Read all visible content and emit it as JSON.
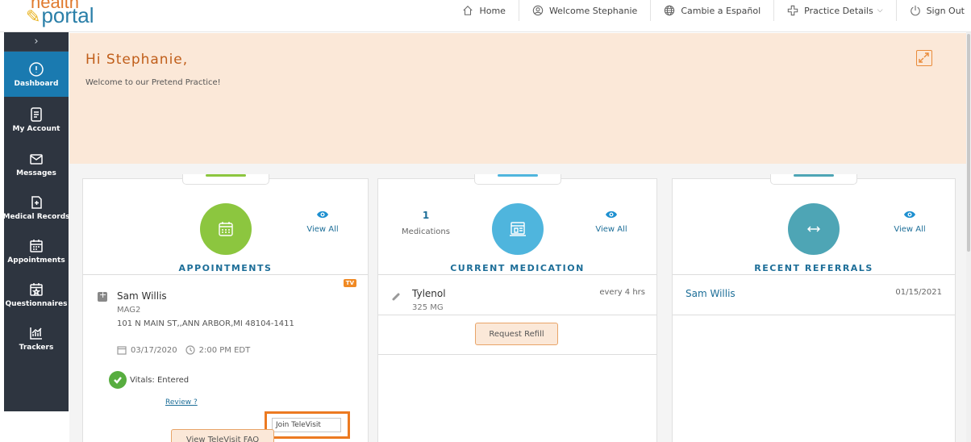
{
  "logo": {
    "line1": "health",
    "line2": "portal"
  },
  "nav": [
    {
      "label": "Home",
      "icon": "home-icon"
    },
    {
      "label": "Welcome Stephanie",
      "icon": "user-icon"
    },
    {
      "label": "Cambie a Español",
      "icon": "globe-icon"
    },
    {
      "label": "Practice Details",
      "icon": "medical-cross-icon"
    },
    {
      "label": "Sign Out",
      "icon": "power-icon"
    }
  ],
  "sidebar": {
    "toggle": "›",
    "items": [
      {
        "label": "Dashboard",
        "icon": "dashboard-icon",
        "active": true
      },
      {
        "label": "My Account",
        "icon": "document-icon"
      },
      {
        "label": "Messages",
        "icon": "envelope-icon"
      },
      {
        "label": "Medical Records",
        "icon": "medical-record-icon"
      },
      {
        "label": "Appointments",
        "icon": "calendar-icon"
      },
      {
        "label": "Questionnaires",
        "icon": "star-calendar-icon"
      },
      {
        "label": "Trackers",
        "icon": "chart-icon"
      }
    ]
  },
  "welcome": {
    "greeting": "Hi Stephanie,",
    "subtitle": "Welcome to our Pretend Practice!"
  },
  "colors": {
    "accent_orange": "#e98b3a",
    "brand_blue": "#1d6e98",
    "appointments_green": "#8cc63f",
    "medication_blue": "#4fb5dd",
    "referrals_teal": "#4ea5b5"
  },
  "cards": {
    "appointments": {
      "title": "APPOINTMENTS",
      "view_all": "View All",
      "badge": "TV",
      "doctor": "Sam Willis",
      "location": "MAG2",
      "address": "101 N MAIN ST,,ANN ARBOR,MI 48104-1411",
      "date": "03/17/2020",
      "time": "2:00 PM EDT",
      "vitals": "Vitals: Entered",
      "review": "Review ?",
      "join_label": "Join TeleVisit",
      "faq_label": "View TeleVisit FAQ"
    },
    "medication": {
      "title": "CURRENT MEDICATION",
      "count": "1",
      "count_label": "Medications",
      "view_all": "View All",
      "name": "Tylenol",
      "dose": "325 MG",
      "frequency": "every 4 hrs",
      "refill_label": "Request Refill"
    },
    "referrals": {
      "title": "RECENT REFERRALS",
      "view_all": "View All",
      "name": "Sam Willis",
      "date": "01/15/2021"
    }
  }
}
